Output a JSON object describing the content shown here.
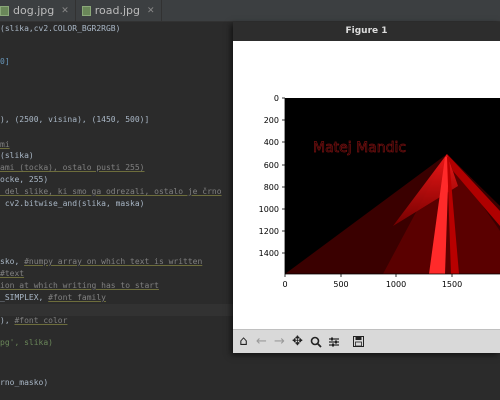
{
  "tabs": [
    {
      "label": "dog.jpg"
    },
    {
      "label": "road.jpg"
    }
  ],
  "figure": {
    "title": "Figure 1",
    "image_text": "Matej Mandic",
    "y_ticks": [
      "0",
      "200",
      "400",
      "600",
      "800",
      "1000",
      "1200",
      "1400"
    ],
    "x_ticks": [
      "0",
      "500",
      "1000",
      "1500"
    ]
  },
  "code": {
    "l1": "(slika,cv2.COLOR_BGR2RGB)",
    "l2": "0]",
    "l3a": "), (2500, visina), (1450, 500)]",
    "l4": "mi",
    "l5": "(slika)",
    "l6": "ami (tocka), ostalo pusti 255)",
    "l7": "ocke, 255)",
    "l8": " del slike, ki smo ga odrezali, ostalo je črno",
    "l9": " cv2.bitwise_and(slika, maska)",
    "l10a": "sko, ",
    "l10b": "#numpy array on which text is written",
    "l11": "#text",
    "l12": "ion at which writing has to start",
    "l13a": "_SIMPLEX, ",
    "l13b": "#font family",
    "l14a": "), ",
    "l14b": "#font color",
    "l15": "pg', slika)",
    "l16": "rno_masko)"
  },
  "toolbar": {
    "home_icon": "home-icon",
    "back_icon": "back-arrow-icon",
    "forward_icon": "forward-arrow-icon",
    "pan_icon": "pan-icon",
    "zoom_icon": "zoom-icon",
    "configure_icon": "configure-subplots-icon",
    "save_icon": "save-icon"
  }
}
